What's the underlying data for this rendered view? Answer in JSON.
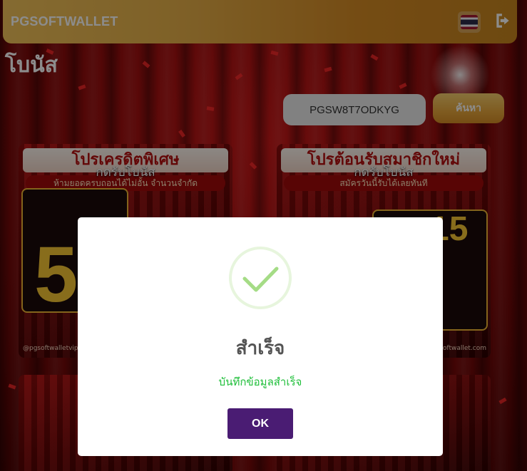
{
  "header": {
    "brand": "PGSOFTWALLET",
    "flag_icon": "thailand-flag-icon",
    "logout_icon": "logout-icon"
  },
  "page": {
    "title": "โบนัส"
  },
  "search": {
    "value": "PGSW8T7ODKYG",
    "button_label": "ค้นหา"
  },
  "cards": [
    {
      "banner": "โปรเครดิตพิเศษ",
      "sub": "ห้ามยอดครบถอนได้ไม่อั้น จำนวนจำกัด",
      "claim": "กดรับโบนัส",
      "big": "5",
      "footer": "@pgsoftwalletvip"
    },
    {
      "banner": "โปรต้อนรับสมาชิกใหม่",
      "sub": "สมัครวันนี้รับได้เลยทันที",
      "claim": "กดรับโบนัส",
      "big": "15",
      "footer": "pgsoftwallet.com"
    }
  ],
  "modal": {
    "title": "สำเร็จ",
    "message": "บันทึกข้อมูลสำเร็จ",
    "ok_label": "OK",
    "success_icon": "check-circle-icon",
    "colors": {
      "check": "#a5dc86",
      "message": "#1fbf3a",
      "button": "#4a1c73"
    }
  },
  "colors": {
    "header_start": "#f2c35a",
    "header_end": "#c8861e",
    "background": "#a00a0a"
  }
}
